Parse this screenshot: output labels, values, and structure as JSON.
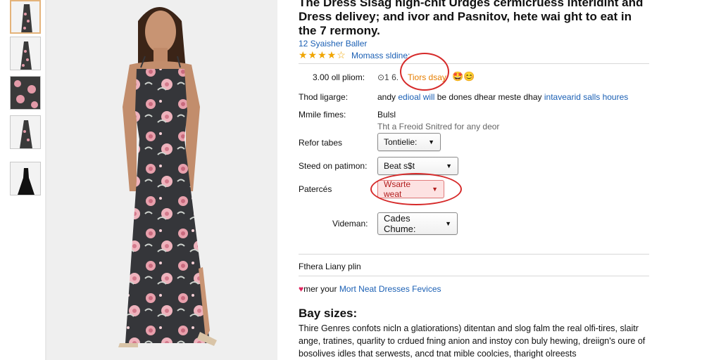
{
  "thumbnails": [
    {
      "name": "thumbnail-1",
      "colors": [
        "#3a3a3a",
        "#e39aa8"
      ]
    },
    {
      "name": "thumbnail-2",
      "colors": [
        "#3a3a3a",
        "#e39aa8"
      ]
    },
    {
      "name": "thumbnail-3",
      "colors": [
        "#3a3a3a",
        "#e39aa8"
      ]
    },
    {
      "name": "thumbnail-4",
      "colors": [
        "#3a3a3a",
        "#e39aa8"
      ]
    },
    {
      "name": "thumbnail-5",
      "colors": [
        "#111111",
        "#e39aa8"
      ]
    }
  ],
  "product": {
    "title": "The Dress Sisag high-chit Urdges cermicruess interldint and Dress delivey; and ivor and Pasnitov, hete wai ght to eat in the 7 rermony.",
    "brand": "12 Syaisher Baller",
    "stars": "★★★★☆",
    "rating_link": "Momass sldine:"
  },
  "price": {
    "label": "3.00 oll pliom:",
    "value": "⊙1 6.",
    "badge": "Tiors dsay",
    "emoji": "🤩😊"
  },
  "delivery": {
    "label": "Thod ligarge:",
    "text_start": "andy",
    "link1": "edioal will",
    "text_mid": "be dones dhear meste dhay",
    "link2": "intavearid salls houres"
  },
  "returns": {
    "label": "Mmile fimes:",
    "line1": "Bulsl",
    "line2": "Tht a Freoid Snitred for any deor"
  },
  "selects": [
    {
      "label": "Refor tabes",
      "value": "Tontielie:"
    },
    {
      "label": "Steed on patimon:",
      "value": "Beat s$t"
    },
    {
      "label": "Patercés",
      "value": "Wsarte weat"
    },
    {
      "label": "Videman:",
      "value": "Cades Chume:"
    }
  ],
  "section_link": "Fthera Liany plin",
  "promo": {
    "heart": "♥",
    "text": "mer your",
    "link": "Mort Neat Dresses Fevices"
  },
  "sizes": {
    "heading": "Bay sizes:",
    "paragraph": "Thire Genres confots nicln a glatiorations) ditentan and slog falm the real olfi-tires, slaitr ange, tratines, quarlity to crdued fning anion and instoy con buly hewing, dreiign's oure of bosolives idles that serwests, ancd tnat mible coolcies, tharight olreests"
  },
  "colors": {
    "link": "#1a5fb4",
    "star": "#f0a500",
    "circle": "#d62a2a",
    "badge": "#e67e00"
  }
}
